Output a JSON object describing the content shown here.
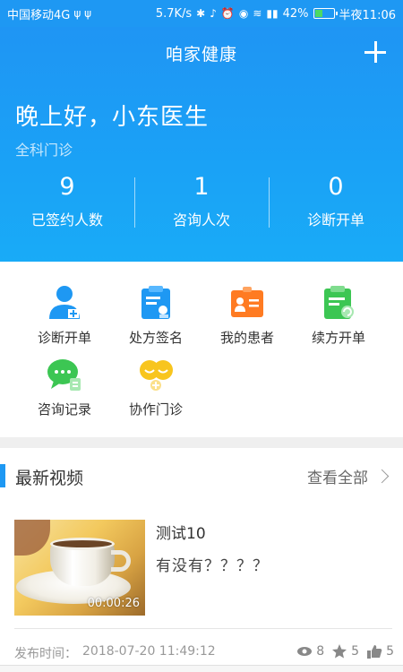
{
  "status_bar": {
    "carrier": "中国移动4G",
    "usb_glyph": "ψ ψ",
    "speed": "5.7K/s",
    "battery_percent": "42%",
    "battery_level": 0.42,
    "time": "半夜11:06"
  },
  "header": {
    "title": "咱家健康",
    "greeting": "晚上好，小东医生",
    "department": "全科门诊"
  },
  "stats": [
    {
      "value": "9",
      "label": "已签约人数"
    },
    {
      "value": "1",
      "label": "咨询人次"
    },
    {
      "value": "0",
      "label": "诊断开单"
    }
  ],
  "menu": [
    {
      "label": "诊断开单",
      "icon": "doctor-icon",
      "color": "#1e98f3"
    },
    {
      "label": "处方签名",
      "icon": "prescription-sign-icon",
      "color": "#1e98f3"
    },
    {
      "label": "我的患者",
      "icon": "patient-card-icon",
      "color": "#ff7b22"
    },
    {
      "label": "续方开单",
      "icon": "renew-prescription-icon",
      "color": "#3cc653"
    },
    {
      "label": "咨询记录",
      "icon": "chat-record-icon",
      "color": "#3cc653"
    },
    {
      "label": "协作门诊",
      "icon": "collaboration-icon",
      "color": "#f8c51e"
    }
  ],
  "section": {
    "title": "最新视频",
    "view_all": "查看全部"
  },
  "video": {
    "title": "测试10",
    "description": "有没有？？？？",
    "duration": "00:00:26",
    "publish_label": "发布时间：",
    "publish_time": "2018-07-20 11:49:12",
    "views": "8",
    "stars": "5",
    "likes": "5"
  }
}
